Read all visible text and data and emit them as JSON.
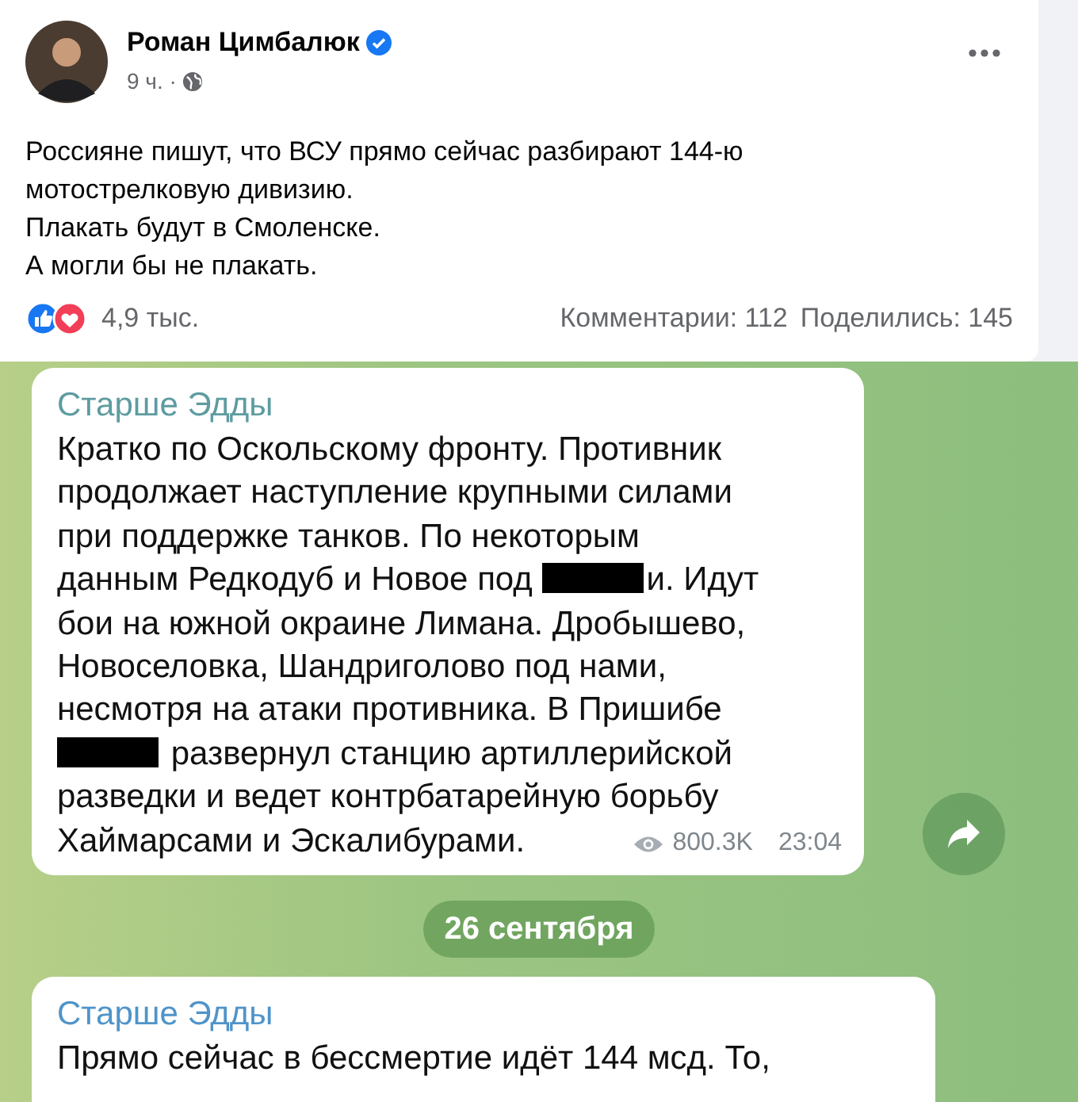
{
  "post": {
    "author": "Роман Цимбалюк",
    "verified": true,
    "time": "9 ч. ·",
    "text": [
      "Россияне пишут, что ВСУ прямо сейчас разбирают 144-ю",
      "мотострелковую дивизию.",
      "Плакать будут в Смоленске.",
      "А могли бы не плакать."
    ],
    "reactions": "4,9 тыс.",
    "comments": "Комментарии: 112",
    "shares": "Поделились: 145"
  },
  "chat": {
    "messages": [
      {
        "kind": "full",
        "sender": "Старше Эдды",
        "views": "800.3K",
        "time": "23:04",
        "lines": [
          [
            {
              "kind": "text",
              "text": "Кратко по Оскольскому фронту. Противник"
            }
          ],
          [
            {
              "kind": "text",
              "text": "продолжает наступление крупными силами"
            }
          ],
          [
            {
              "kind": "text",
              "text": "при поддержке танков. По некоторым"
            }
          ],
          [
            {
              "kind": "text",
              "text": "данным Редкодуб и Новое под "
            },
            {
              "kind": "redacted"
            },
            {
              "kind": "text",
              "text": "и. Идут"
            }
          ],
          [
            {
              "kind": "text",
              "text": "бои на южной окраине Лимана. Дробышево,"
            }
          ],
          [
            {
              "kind": "text",
              "text": "Новоселовка, Шандриголово под нами,"
            }
          ],
          [
            {
              "kind": "text",
              "text": "несмотря на атаки противника. В Пришибе"
            }
          ],
          [
            {
              "kind": "redacted"
            },
            {
              "kind": "text",
              "text": " развернул станцию артиллерийской"
            }
          ],
          [
            {
              "kind": "text",
              "text": "разведки и ведет контрбатарейную борьбу"
            }
          ],
          [
            {
              "kind": "text",
              "text": "Хаймарсами и Эскалибурами."
            }
          ]
        ]
      },
      {
        "kind": "date",
        "text": "26 сентября"
      },
      {
        "kind": "partial",
        "sender": "Старше Эдды",
        "lines": [
          [
            {
              "kind": "text",
              "text": "Прямо сейчас в бессмертие идёт 144 мсд. То,"
            }
          ]
        ]
      }
    ]
  }
}
